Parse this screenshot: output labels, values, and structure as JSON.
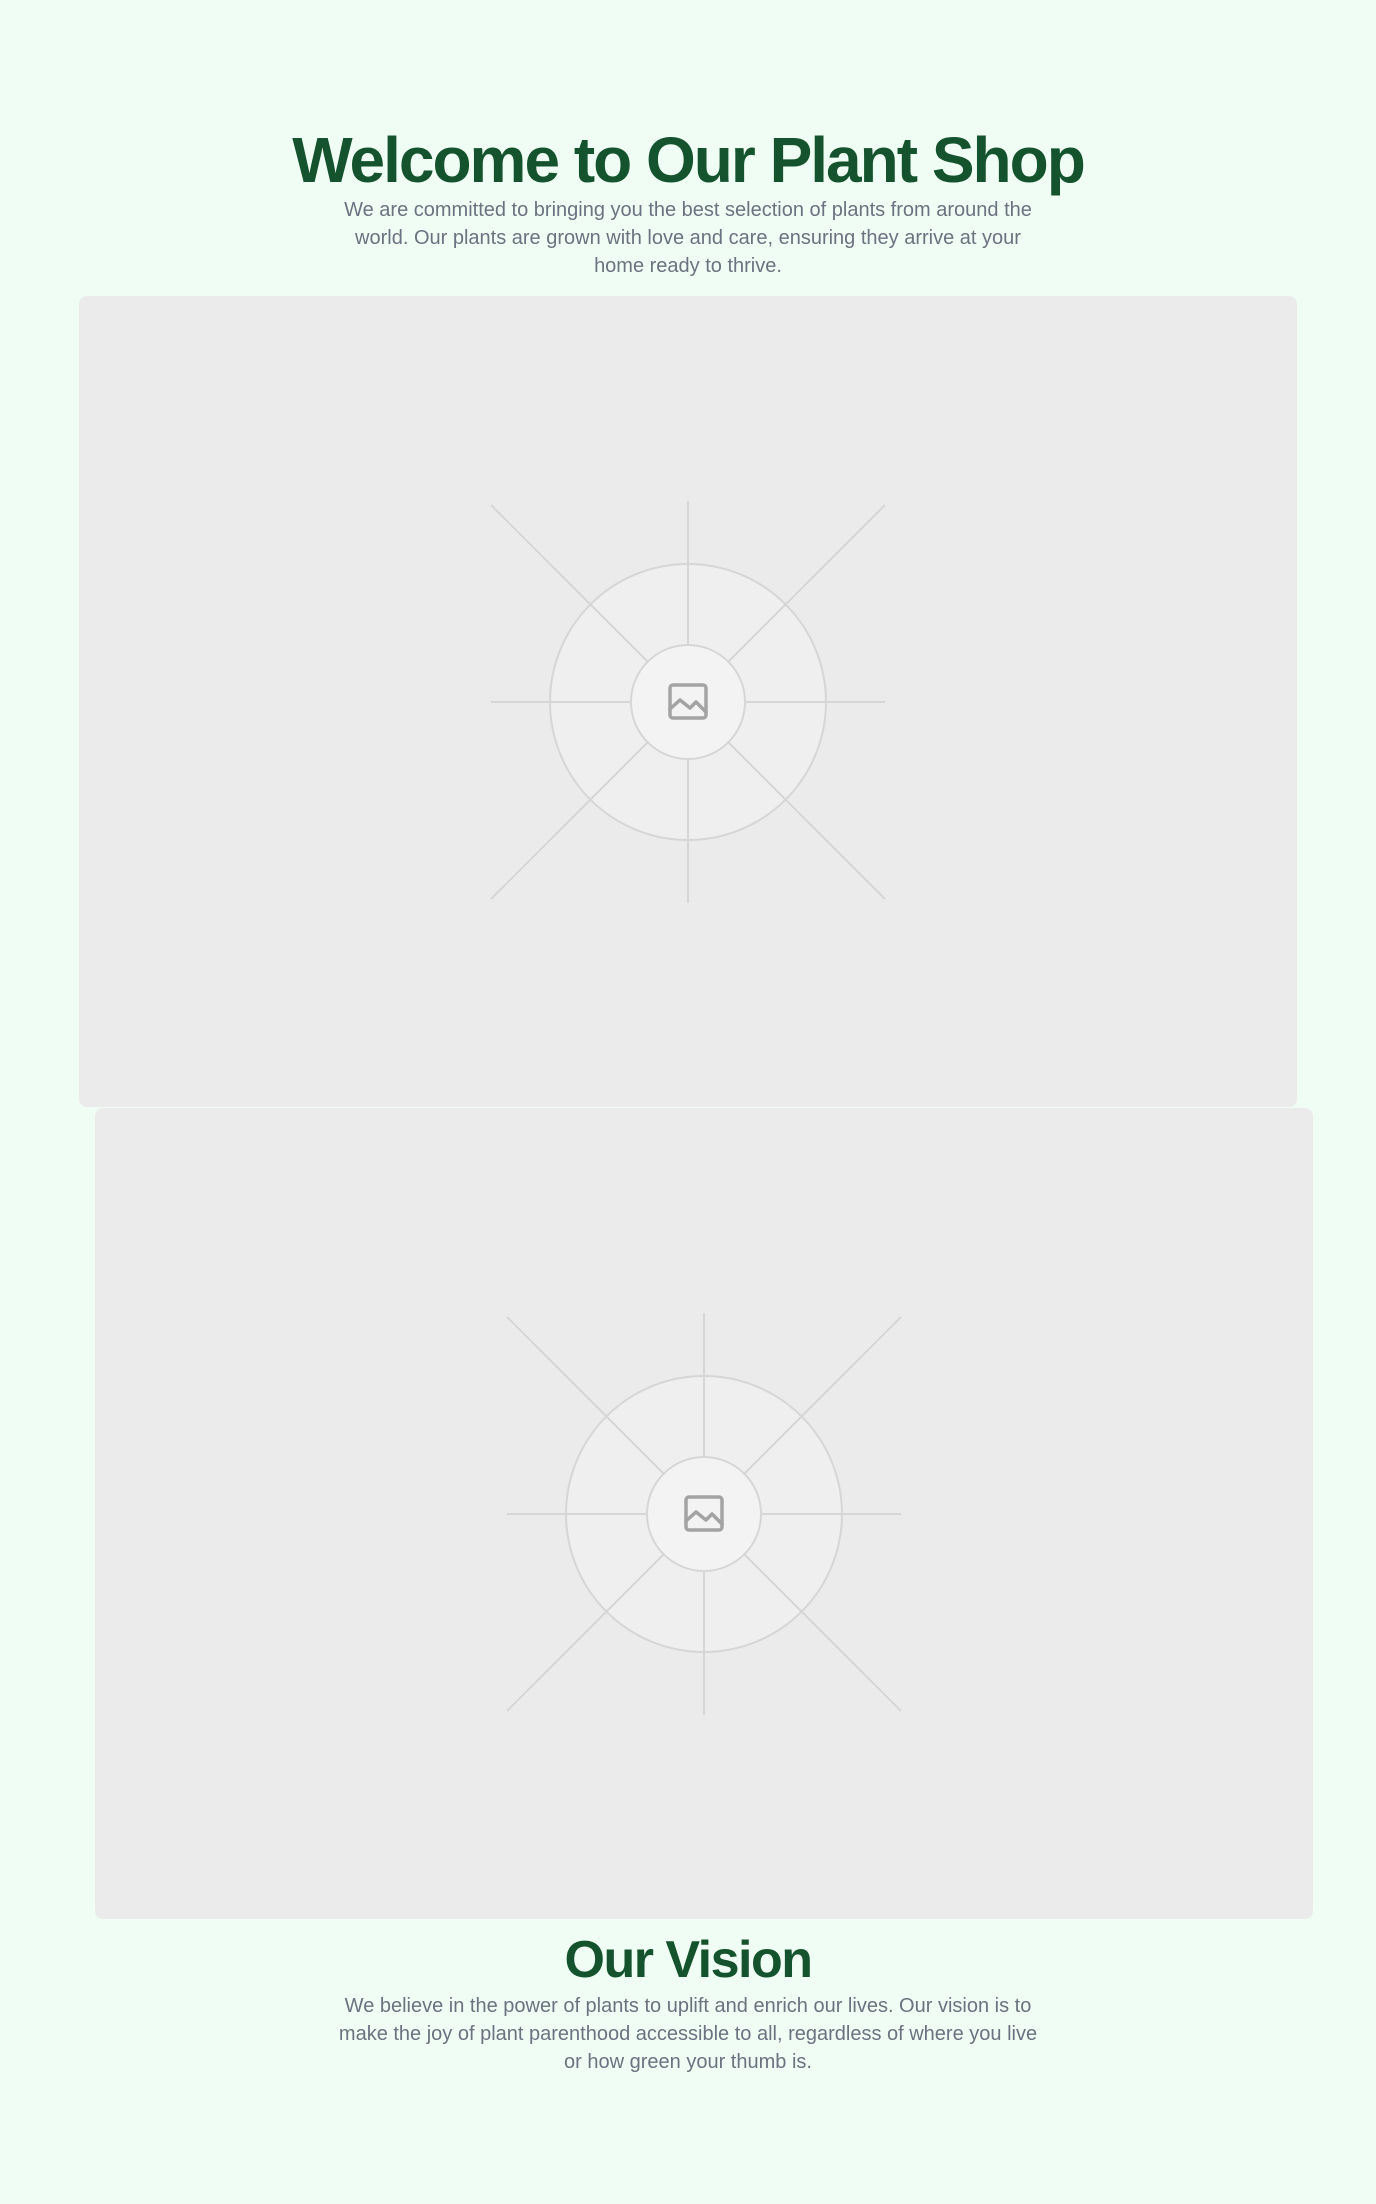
{
  "hero": {
    "title": "Welcome to Our Plant Shop",
    "description": "We are committed to bringing you the best selection of plants from around the world. Our plants are grown with love and care, ensuring they arrive at your home ready to thrive."
  },
  "images": [
    {
      "icon": "image-placeholder-icon"
    },
    {
      "icon": "image-placeholder-icon"
    }
  ],
  "vision": {
    "title": "Our Vision",
    "description": "We believe in the power of plants to uplift and enrich our lives. Our vision is to make the joy of plant parenthood accessible to all, regardless of where you live or how green your thumb is."
  },
  "colors": {
    "background": "#f0fdf4",
    "heading": "#14532d",
    "body_text": "#6b7280",
    "placeholder": "#ebebeb"
  }
}
